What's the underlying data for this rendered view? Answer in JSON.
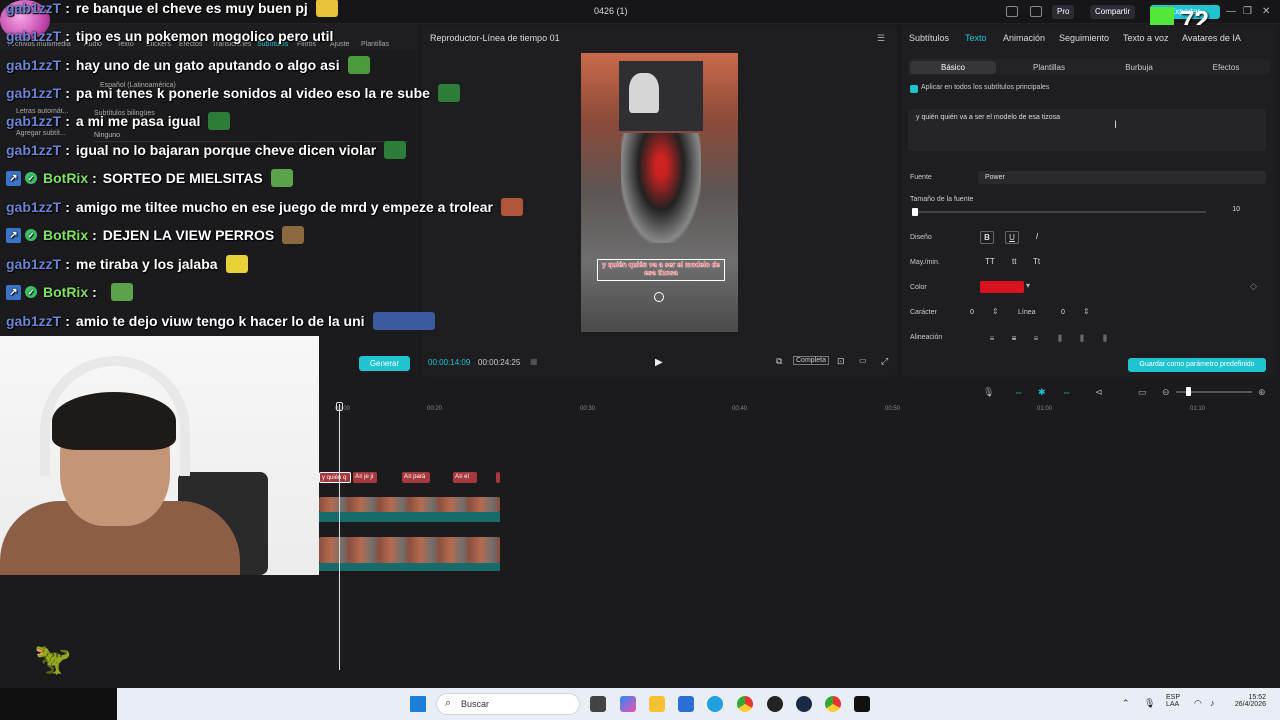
{
  "window": {
    "title": "0426 (1)",
    "pro_label": "Pro",
    "share_label": "Compartir",
    "export_label": "Exportar",
    "overlay_counter": "72"
  },
  "media_tabs": [
    "Archivos multimedia",
    "Audio",
    "Texto",
    "Stickers",
    "Efectos",
    "Transiciones",
    "Subtítulos",
    "Filtros",
    "Ajuste",
    "Plantillas"
  ],
  "subtitle_panel": {
    "lang_value": "Español (Latinoamérica)",
    "auto_lyrics_label": "Letras automát...",
    "bilingual_label": "Subtítulos bilingües",
    "add_subtitle_label": "Agregar subtít...",
    "none_value": "Ninguno",
    "generate_label": "Generar"
  },
  "chat": [
    {
      "user": "gab1zzT",
      "bot": false,
      "text": "re banque el cheve es muy buen pj",
      "emote": "#e8c23a"
    },
    {
      "user": "gab1zzT",
      "bot": false,
      "text": "tipo es un pokemon mogolico pero util",
      "emote": ""
    },
    {
      "user": "gab1zzT",
      "bot": false,
      "text": "hay uno de un gato aputando o algo asi",
      "emote": "#4c9a3c"
    },
    {
      "user": "gab1zzT",
      "bot": false,
      "text": "pa mi tenes k ponerle sonidos al video eso la re sube",
      "emote": "#2d7d3a"
    },
    {
      "user": "gab1zzT",
      "bot": false,
      "text": "a mi me pasa igual",
      "emote": "#2d7d3a"
    },
    {
      "user": "gab1zzT",
      "bot": false,
      "text": "igual no lo bajaran porque cheve dicen violar",
      "emote": "#2d7d3a"
    },
    {
      "user": "BotRix",
      "bot": true,
      "text": "SORTEO DE MIELSITAS",
      "emote": "#5aa34a"
    },
    {
      "user": "gab1zzT",
      "bot": false,
      "text": "amigo me tiltee mucho en ese juego de mrd y empeze a trolear",
      "emote": "#b0563a"
    },
    {
      "user": "BotRix",
      "bot": true,
      "text": "DEJEN LA VIEW PERROS",
      "emote": "#8a6a3c"
    },
    {
      "user": "gab1zzT",
      "bot": false,
      "text": "me tiraba y los jalaba",
      "emote": "#e8d23a"
    },
    {
      "user": "BotRix",
      "bot": true,
      "text": "",
      "emote": "#5aa34a"
    },
    {
      "user": "gab1zzT",
      "bot": false,
      "text": "amio te dejo viuw tengo k hacer lo de la uni",
      "emote": "#3c5aa0"
    }
  ],
  "player": {
    "title": "Reproductor-Línea de tiempo 01",
    "subtitle_overlay": "y quién quién va a ser el modelo de esa tizosa",
    "current_time": "00:00:14:09",
    "total_time": "00:00:24:25",
    "complete_label": "Completa"
  },
  "props": {
    "tabs": [
      "Subtítulos",
      "Texto",
      "Animación",
      "Seguimiento",
      "Texto a voz",
      "Avatares de IA"
    ],
    "active_tab": "Texto",
    "subtabs": [
      "Básico",
      "Plantillas",
      "Burbuja",
      "Efectos"
    ],
    "apply_all_label": "Aplicar en todos los subtítulos principales",
    "text_value": "y quién quién va a ser el modelo de esa tizosa",
    "font_label": "Fuente",
    "font_value": "Power",
    "font_size_label": "Tamaño de la fuente",
    "font_size_value": "10",
    "design_label": "Diseño",
    "case_label": "May./min.",
    "case_options": [
      "TT",
      "tt",
      "Tt"
    ],
    "color_label": "Color",
    "color_value": "#d9121f",
    "char_label": "Carácter",
    "char_value": "0",
    "line_label": "Línea",
    "line_value": "0",
    "align_label": "Alineación",
    "save_preset_label": "Guardar como parámetro predefinido",
    "accent": "#20c4d1"
  },
  "timeline": {
    "ticks": [
      "00:00",
      "00:20",
      "00:30",
      "00:40",
      "00:50",
      "01:00",
      "01:10"
    ],
    "sub_clips": [
      "y quién q",
      "A≡ je ji",
      "A≡ pará",
      "A≡ el"
    ]
  },
  "taskbar": {
    "search_placeholder": "Buscar",
    "lang_line1": "ESP",
    "lang_line2": "LAA",
    "time": "15:52",
    "date": "26/4/2026"
  }
}
